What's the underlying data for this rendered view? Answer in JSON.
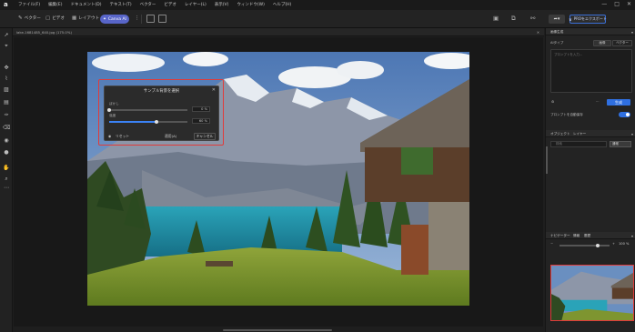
{
  "menubar": {
    "logo": "a",
    "items": [
      "ファイル(F)",
      "編集(E)",
      "ドキュメント(D)",
      "テキスト(T)",
      "ベクター",
      "ビデオ",
      "レイヤー(L)",
      "表示(V)",
      "ウィンドウ(W)",
      "ヘルプ(H)"
    ],
    "window_controls": [
      "—",
      "□",
      "✕"
    ]
  },
  "toolbar": {
    "vector_label": "ベクター",
    "video_label": "ビデオ",
    "layout_label": "レイアウト",
    "canva_label": "Canva AI",
    "pro_label": "PROをエクスポート"
  },
  "document": {
    "tab_title": "lake-1681485_640.jpg (175.0%)",
    "close": "✕"
  },
  "dialog": {
    "title": "サンプル背景を選択",
    "close": "✕",
    "slider1_label": "ぼかし",
    "slider1_value": "0 %",
    "slider1_fraction": 0.0,
    "slider2_label": "強度",
    "slider2_value": "60 %",
    "slider2_fraction": 0.6,
    "reset_label": "リセット",
    "apply_label": "適用(A)",
    "cancel_label": "キャンセル"
  },
  "right_panel": {
    "header1": "画像生成",
    "subheader": "AIタイプ",
    "seg_image": "画像",
    "seg_vector": "ベクター",
    "prompt_placeholder": "プロンプトを入力...",
    "generate_label": "生成",
    "toggle_label": "プロンプトを自動保存",
    "toggle_on": true,
    "layers_tabs": [
      "オブジェクト",
      "レイヤー"
    ],
    "search_placeholder": "検索",
    "blend_mode": "通常",
    "nav_tabs": [
      "ナビゲーター",
      "情報",
      "履歴"
    ],
    "nav_zoom": "100 %"
  },
  "colors": {
    "accent": "#2f6fe0",
    "canva": "#5865c8",
    "highlight": "#e03b3b"
  }
}
